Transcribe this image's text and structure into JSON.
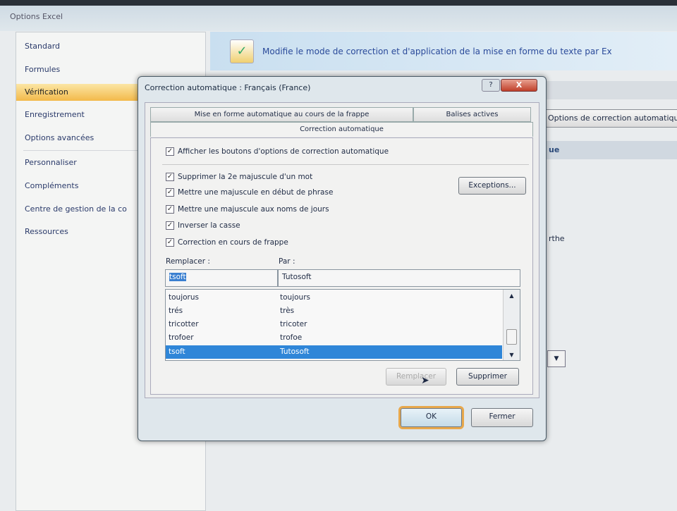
{
  "window": {
    "title": "Options Excel"
  },
  "nav": {
    "items": [
      "Standard",
      "Formules",
      "Vérification",
      "Enregistrement",
      "Options avancées",
      "Personnaliser",
      "Compléments",
      "Centre de gestion de la co",
      "Ressources"
    ]
  },
  "banner": {
    "text": "Modifie le mode de correction et d'application de la mise en forme du texte par Ex"
  },
  "background": {
    "autocorrect_button": "Options de correction automatique...",
    "section_fragment": "ue",
    "text_fragment": "rthe"
  },
  "dialog": {
    "title": "Correction automatique : Français (France)",
    "help": "?",
    "close": "X",
    "tabs": [
      "Mise en forme automatique au cours de la frappe",
      "Balises actives",
      "Correction automatique"
    ],
    "checkboxes": [
      {
        "label": "Afficher les boutons d'options de correction automatique",
        "checked": true
      },
      {
        "label": "Supprimer la 2e majuscule d'un mot",
        "checked": true
      },
      {
        "label": "Mettre une majuscule en début de phrase",
        "checked": true
      },
      {
        "label": "Mettre une majuscule aux noms de jours",
        "checked": true
      },
      {
        "label": "Inverser la casse",
        "checked": true
      },
      {
        "label": "Correction en cours de frappe",
        "checked": true
      }
    ],
    "exceptions_label": "Exceptions...",
    "replace_label": "Remplacer :",
    "with_label": "Par :",
    "replace_value": "tsoft",
    "with_value": "Tutosoft",
    "rows": [
      {
        "from": "toujorus",
        "to": "toujours"
      },
      {
        "from": "trés",
        "to": "très"
      },
      {
        "from": "tricotter",
        "to": "tricoter"
      },
      {
        "from": "trofoer",
        "to": "trofoe"
      },
      {
        "from": "tsoft",
        "to": "Tutosoft",
        "selected": true
      }
    ],
    "replace_button": "Remplacer",
    "delete_button": "Supprimer",
    "ok_button": "OK",
    "close_button": "Fermer"
  }
}
